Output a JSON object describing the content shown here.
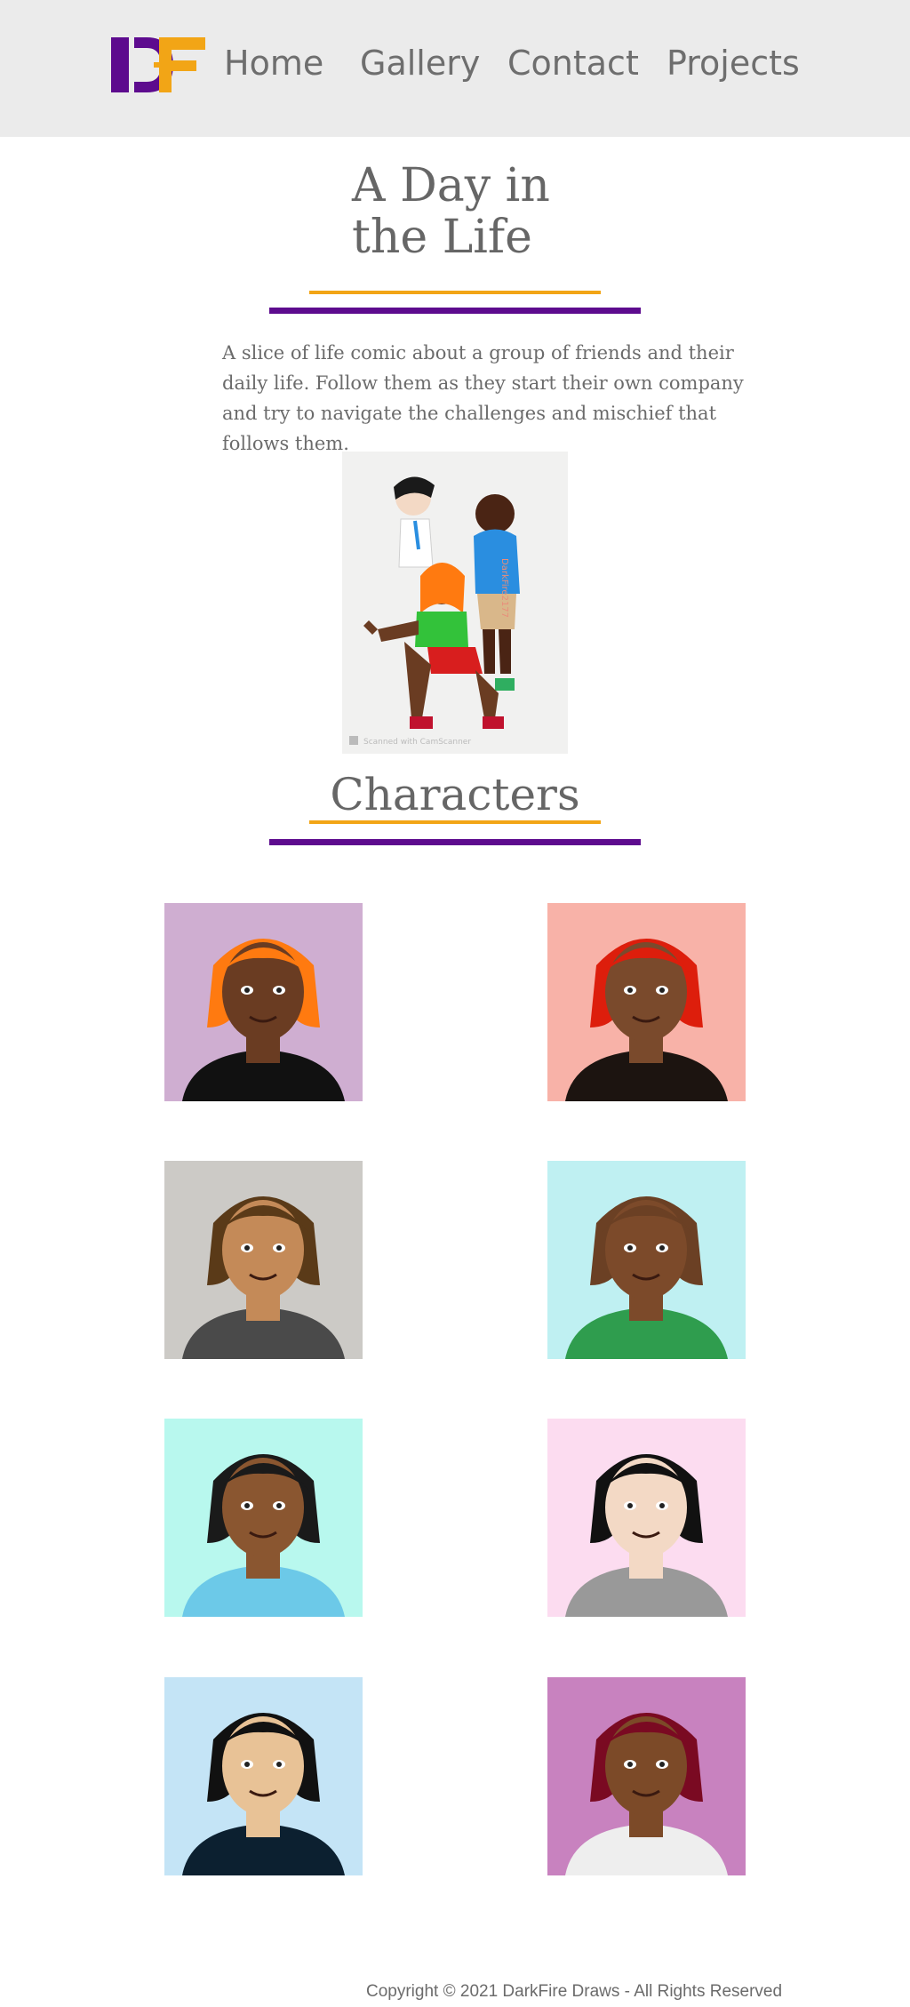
{
  "nav": {
    "logo_alt": "DF",
    "links": [
      {
        "label": "Home"
      },
      {
        "label": "Gallery"
      },
      {
        "label": "Contact"
      },
      {
        "label": "Projects"
      }
    ]
  },
  "page": {
    "title": "A Day in the Life",
    "description": "A slice of life comic about a group of friends and their daily life. Follow them as they start their own company and try to navigate the challenges and mischief that follows them.",
    "cover_watermark": "DarkFire2177",
    "cover_caption": "Scanned with CamScanner"
  },
  "characters": {
    "heading": "Characters",
    "items": [
      {
        "bg": "#cfaed1",
        "hair": "#ff7a10",
        "skin": "#6a3c22",
        "shirt": "#111111"
      },
      {
        "bg": "#f8b2a8",
        "hair": "#dd1e0c",
        "skin": "#7a4a2c",
        "shirt": "#1c1410"
      },
      {
        "bg": "#cccac6",
        "hair": "#5a3a18",
        "skin": "#c48a58",
        "shirt": "#4a4a4a"
      },
      {
        "bg": "#bff0f2",
        "hair": "#6b4024",
        "skin": "#7c4a2a",
        "shirt": "#2f9d4e"
      },
      {
        "bg": "#b8f8ee",
        "hair": "#1a1a1a",
        "skin": "#8a5630",
        "shirt": "#6cc9e8"
      },
      {
        "bg": "#fcdcf0",
        "hair": "#111111",
        "skin": "#f3d9c5",
        "shirt": "#999999"
      },
      {
        "bg": "#c4e4f6",
        "hair": "#111111",
        "skin": "#e8c296",
        "shirt": "#0c2030"
      },
      {
        "bg": "#c882bf",
        "hair": "#7a0a22",
        "skin": "#7c4a28",
        "shirt": "#eeeeee"
      }
    ]
  },
  "footer": {
    "text": "Copyright © 2021 DarkFire Draws - All Rights Reserved"
  }
}
